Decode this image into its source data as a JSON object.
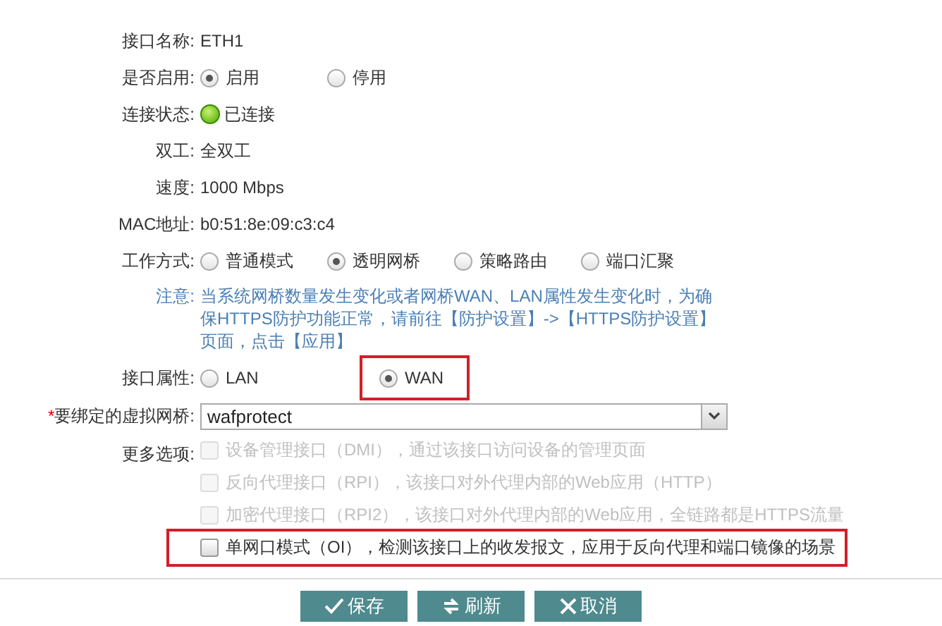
{
  "fields": [
    {
      "kind": "text",
      "label": "接口名称:",
      "value": "ETH1"
    },
    {
      "kind": "radio",
      "label": "是否启用:",
      "options": [
        {
          "label": "启用",
          "selected": true,
          "highlighted": false
        },
        {
          "label": "停用",
          "selected": false,
          "highlighted": false
        }
      ]
    },
    {
      "kind": "status",
      "label": "连接状态:",
      "value": "已连接",
      "connected": true
    },
    {
      "kind": "text",
      "label": "双工:",
      "value": "全双工"
    },
    {
      "kind": "text",
      "label": "速度:",
      "value": "1000 Mbps"
    },
    {
      "kind": "text",
      "label": "MAC地址:",
      "value": "b0:51:8e:09:c3:c4"
    },
    {
      "kind": "radio",
      "label": "工作方式:",
      "options": [
        {
          "label": "普通模式",
          "selected": false,
          "highlighted": false
        },
        {
          "label": "透明网桥",
          "selected": true,
          "highlighted": false
        },
        {
          "label": "策略路由",
          "selected": false,
          "highlighted": false
        },
        {
          "label": "端口汇聚",
          "selected": false,
          "highlighted": false
        }
      ]
    },
    {
      "kind": "notice",
      "label": "注意:",
      "value": "当系统网桥数量发生变化或者网桥WAN、LAN属性发生变化时，为确保HTTPS防护功能正常，请前往【防护设置】->【HTTPS防护设置】页面，点击【应用】"
    },
    {
      "kind": "radio",
      "label": "接口属性:",
      "options": [
        {
          "label": "LAN",
          "selected": false,
          "highlighted": false
        },
        {
          "label": "WAN",
          "selected": true,
          "highlighted": true
        }
      ]
    },
    {
      "kind": "select",
      "label": "要绑定的虚拟网桥:",
      "required_mark": "*",
      "value": "wafprotect"
    },
    {
      "kind": "checks",
      "label": "更多选项:",
      "options": [
        {
          "label": "设备管理接口（DMI），通过该接口访问设备的管理页面",
          "checked": false,
          "disabled": true,
          "highlighted": false
        },
        {
          "label": "反向代理接口（RPI），该接口对外代理内部的Web应用（HTTP）",
          "checked": false,
          "disabled": true,
          "highlighted": false
        },
        {
          "label": "加密代理接口（RPI2），该接口对外代理内部的Web应用，全链路都是HTTPS流量",
          "checked": false,
          "disabled": true,
          "highlighted": false
        },
        {
          "label": "单网口模式（OI），检测该接口上的收发报文，应用于反向代理和端口镜像的场景",
          "checked": false,
          "disabled": false,
          "highlighted": true
        }
      ]
    }
  ],
  "buttons": [
    {
      "kind": "save",
      "label": "保存"
    },
    {
      "kind": "refresh",
      "label": "刷新"
    },
    {
      "kind": "cancel",
      "label": "取消"
    }
  ]
}
